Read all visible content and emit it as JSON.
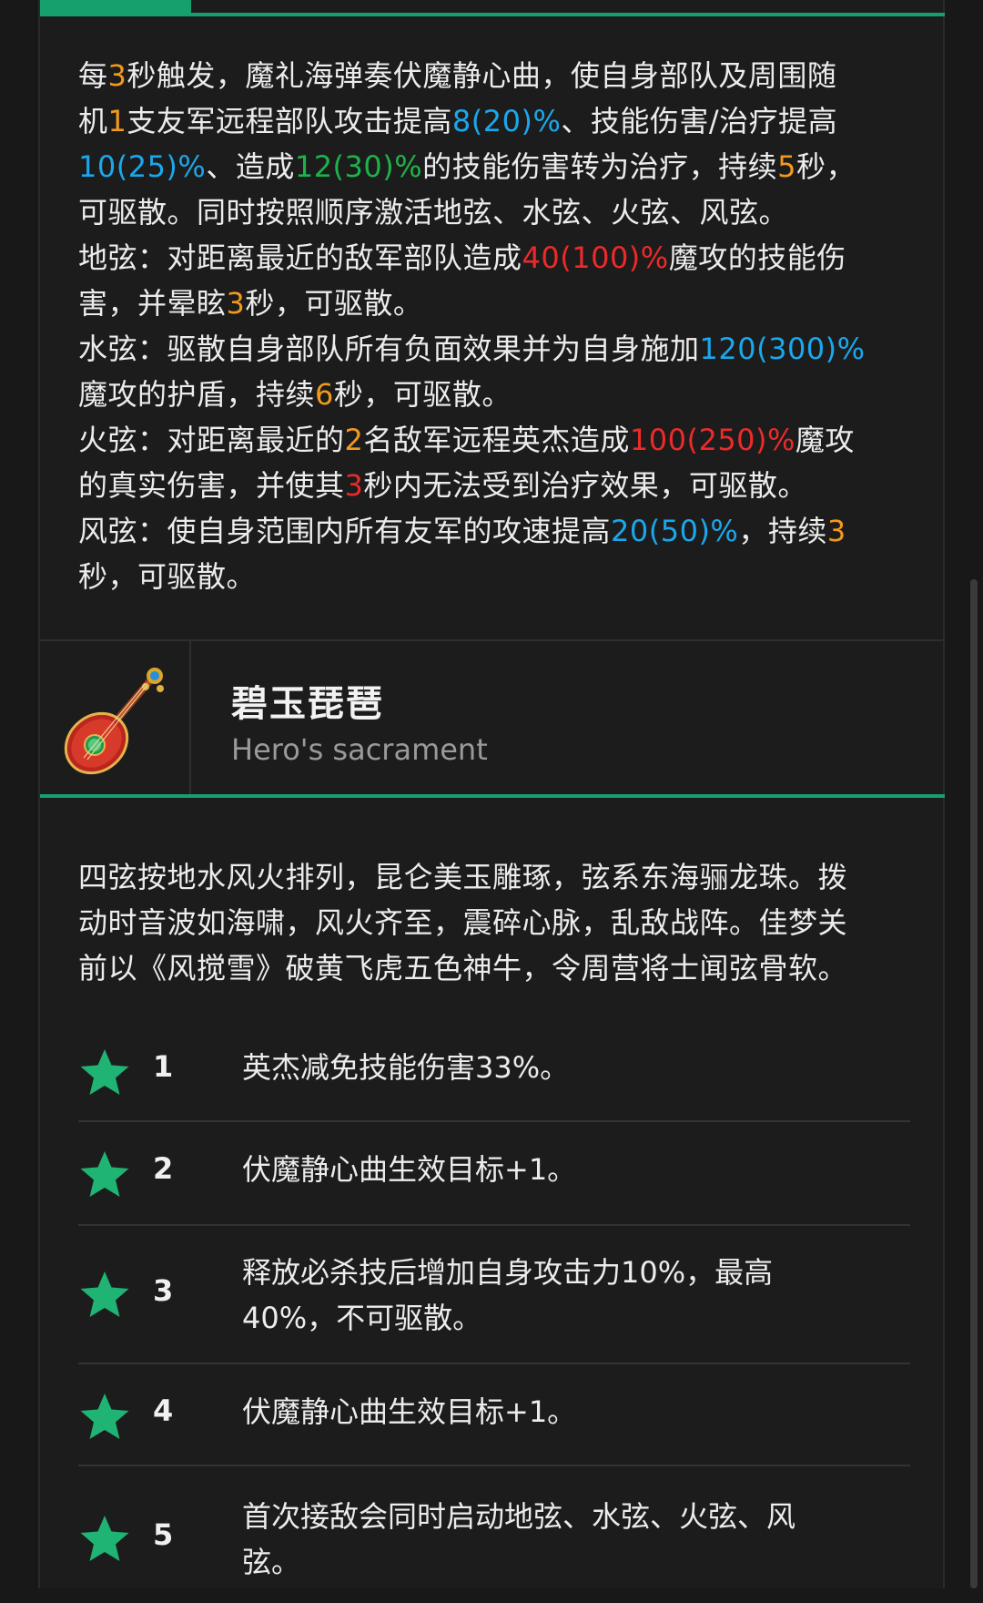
{
  "skill": {
    "lines": [
      [
        {
          "t": "每"
        },
        {
          "t": "3",
          "c": "orange"
        },
        {
          "t": "秒触发，魔礼海弹奏伏魔静心曲，使自身部队及周围随"
        }
      ],
      [
        {
          "t": "机"
        },
        {
          "t": "1",
          "c": "orange"
        },
        {
          "t": "支友军远程部队攻击提高"
        },
        {
          "t": "8(20)%",
          "c": "blue"
        },
        {
          "t": "、技能伤害/治疗提高"
        }
      ],
      [
        {
          "t": "10(25)%",
          "c": "blue"
        },
        {
          "t": "、造成"
        },
        {
          "t": "12(30)%",
          "c": "green"
        },
        {
          "t": "的技能伤害转为治疗，持续"
        },
        {
          "t": "5",
          "c": "orange"
        },
        {
          "t": "秒，"
        }
      ],
      [
        {
          "t": "可驱散。同时按照顺序激活地弦、水弦、火弦、风弦。"
        }
      ],
      [
        {
          "t": "地弦：对距离最近的敌军部队造成"
        },
        {
          "t": "40(100)%",
          "c": "red"
        },
        {
          "t": "魔攻的技能伤"
        }
      ],
      [
        {
          "t": "害，并晕眩"
        },
        {
          "t": "3",
          "c": "orange"
        },
        {
          "t": "秒，可驱散。"
        }
      ],
      [
        {
          "t": "水弦：驱散自身部队所有负面效果并为自身施加"
        },
        {
          "t": "120(300)%",
          "c": "blue"
        }
      ],
      [
        {
          "t": "魔攻的护盾，持续"
        },
        {
          "t": "6",
          "c": "orange"
        },
        {
          "t": "秒，可驱散。"
        }
      ],
      [
        {
          "t": "火弦：对距离最近的"
        },
        {
          "t": "2",
          "c": "orange"
        },
        {
          "t": "名敌军远程英杰造成"
        },
        {
          "t": "100(250)%",
          "c": "red"
        },
        {
          "t": "魔攻"
        }
      ],
      [
        {
          "t": "的真实伤害，并使其"
        },
        {
          "t": "3",
          "c": "red"
        },
        {
          "t": "秒内无法受到治疗效果，可驱散。"
        }
      ],
      [
        {
          "t": "风弦：使自身范围内所有友军的攻速提高"
        },
        {
          "t": "20(50)%",
          "c": "blue"
        },
        {
          "t": "，持续"
        },
        {
          "t": "3",
          "c": "orange"
        }
      ],
      [
        {
          "t": "秒，可驱散。"
        }
      ]
    ]
  },
  "item": {
    "title": "碧玉琵琶",
    "subtitle": "Hero's sacrament",
    "icon": "pipa-lute-icon"
  },
  "lore": {
    "lines": [
      "四弦按地水风火排列，昆仑美玉雕琢，弦系东海骊龙珠。拨",
      "动时音波如海啸，风火齐至，震碎心脉，乱敌战阵。佳梦关",
      "前以《风搅雪》破黄飞虎五色神牛，令周营将士闻弦骨软。"
    ]
  },
  "stars": [
    {
      "num": "1",
      "lines": [
        "英杰减免技能伤害33%。"
      ]
    },
    {
      "num": "2",
      "lines": [
        "伏魔静心曲生效目标+1。"
      ]
    },
    {
      "num": "3",
      "lines": [
        "释放必杀技后增加自身攻击力10%，最高",
        "40%，不可驱散。"
      ]
    },
    {
      "num": "4",
      "lines": [
        "伏魔静心曲生效目标+1。"
      ]
    },
    {
      "num": "5",
      "lines": [
        "首次接敌会同时启动地弦、水弦、火弦、风",
        "弦。"
      ]
    }
  ],
  "colors": {
    "accent": "#16a06d",
    "star": "#1fb374",
    "orange": "#f19a1c",
    "blue": "#1aa7ec",
    "green": "#1cb34a",
    "red": "#ec2a2a"
  }
}
